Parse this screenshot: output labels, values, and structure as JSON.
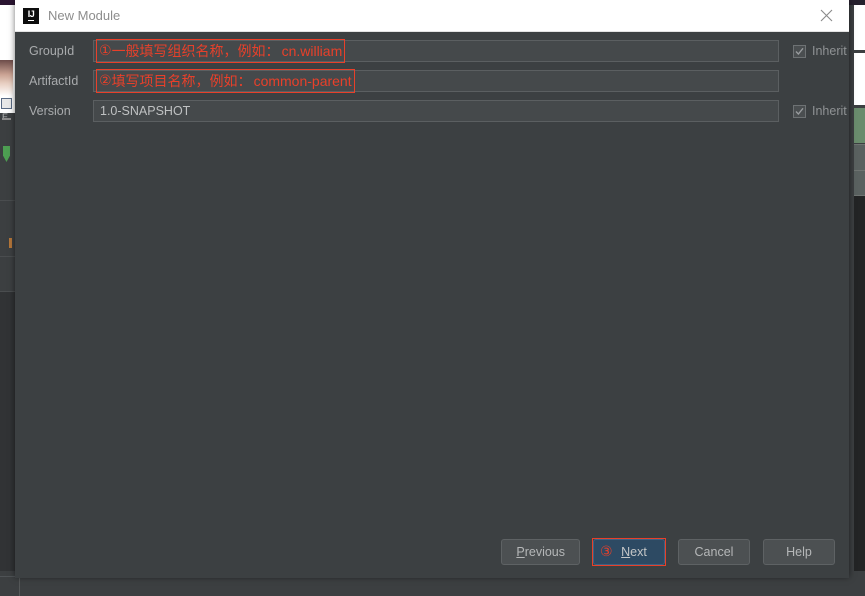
{
  "window": {
    "title": "New Module",
    "logo_text": "IJ",
    "close_icon": "close-icon"
  },
  "form": {
    "rows": [
      {
        "label": "GroupId",
        "value": "",
        "annotation": {
          "number": "①",
          "text": "一般填写组织名称，例如：",
          "example": "cn.william"
        },
        "inherit": {
          "label": "Inherit",
          "checked": true,
          "enabled": false
        }
      },
      {
        "label": "ArtifactId",
        "value": "",
        "annotation": {
          "number": "②",
          "text": "填写项目名称，例如：",
          "example": "common-parent"
        },
        "inherit": null
      },
      {
        "label": "Version",
        "value": "1.0-SNAPSHOT",
        "annotation": null,
        "inherit": {
          "label": "Inherit",
          "checked": true,
          "enabled": false
        }
      }
    ]
  },
  "footer": {
    "buttons": [
      {
        "name": "previous",
        "label_pre": "",
        "mnemonic": "P",
        "label_post": "revious",
        "default": false,
        "annotation": null
      },
      {
        "name": "next",
        "label_pre": "",
        "mnemonic": "N",
        "label_post": "ext",
        "default": true,
        "annotation": "③"
      },
      {
        "name": "cancel",
        "label_pre": "Cancel",
        "mnemonic": "",
        "label_post": "",
        "default": false,
        "annotation": null
      },
      {
        "name": "help",
        "label_pre": "Help",
        "mnemonic": "",
        "label_post": "",
        "default": false,
        "annotation": null
      }
    ]
  },
  "colors": {
    "dialog_bg": "#3c4042",
    "field_bg": "#45494b",
    "annotation_red": "#e8402a",
    "default_button_bg": "#2d4a63",
    "titlebar_bg": "#ffffff"
  },
  "background_window": {
    "tab_hint": "E"
  }
}
